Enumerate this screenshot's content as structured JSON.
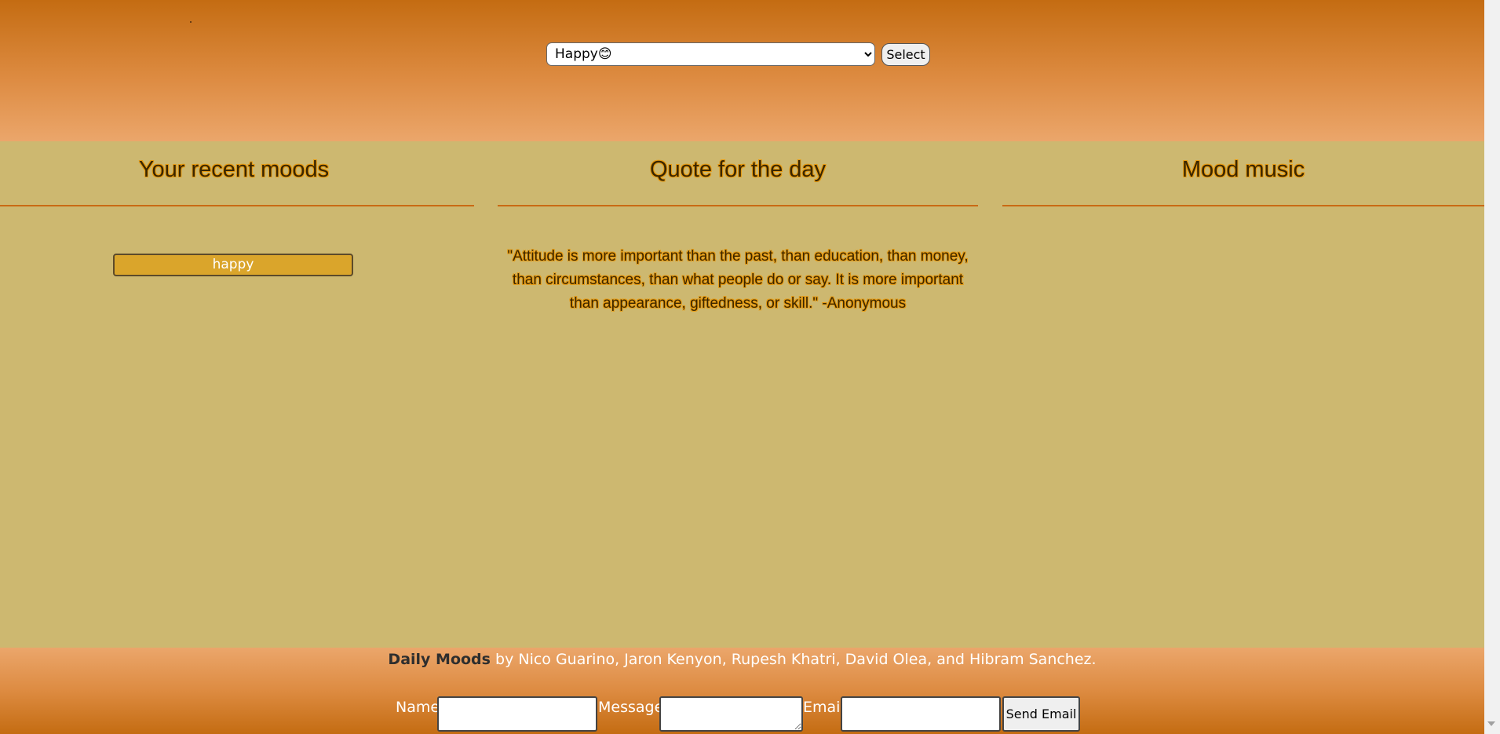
{
  "header": {
    "mood_select": {
      "selected": "Happy😊"
    },
    "select_button_label": "Select"
  },
  "columns": {
    "recent": {
      "title": "Your recent moods",
      "items": [
        "happy"
      ]
    },
    "quote": {
      "title": "Quote for the day",
      "text": "\"Attitude is more important than the past, than education, than money, than circumstances, than what people do or say. It is more important than appearance, giftedness, or skill.\" -Anonymous"
    },
    "music": {
      "title": "Mood music"
    }
  },
  "footer": {
    "app_name": "Daily Moods",
    "credits_rest": " by Nico Guarino, Jaron Kenyon, Rupesh Khatri, David Olea, and Hibram Sanchez.",
    "contact": {
      "name_label": "Name",
      "message_label": "Message",
      "email_label": "Email",
      "send_label": "Send Email"
    }
  },
  "colors": {
    "header_top": "#c46c12",
    "header_bottom": "#eba66b",
    "main_background": "#cdb870",
    "accent_rule": "#c96a14",
    "mood_item": "#daa52b"
  },
  "icons": {
    "select_chevron": "chevron-down-icon",
    "scroll_down": "scroll-down-arrow-icon"
  }
}
